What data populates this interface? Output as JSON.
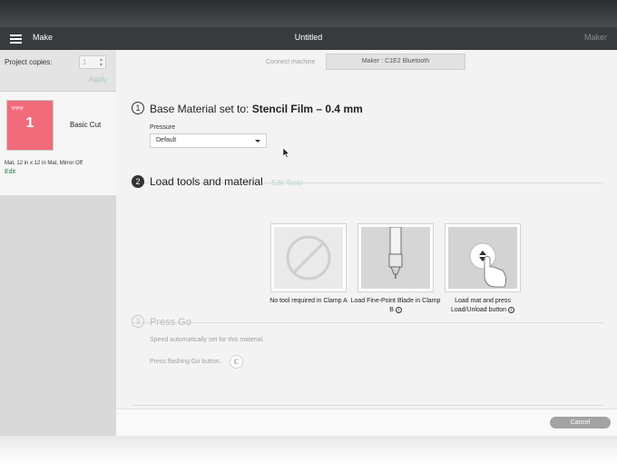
{
  "window": {
    "menu_label": "Make",
    "title": "Untitled",
    "right_label": "Maker"
  },
  "sidebar": {
    "copies_label": "Project copies:",
    "copies_value": "1",
    "apply_label": "Apply",
    "mat": {
      "number": "1",
      "name": "Basic Cut",
      "info": "Mat, 12 in x 12 in Mat, Mirror Off",
      "edit_label": "Edit"
    }
  },
  "connect": {
    "label": "Connect machine",
    "machine_button": "Maker : C1E2 Bluetooth"
  },
  "step1": {
    "number": "1",
    "prefix": "Base Material set to:",
    "material": "Stencil Film – 0.4 mm",
    "pressure_label": "Pressure",
    "pressure_value": "Default"
  },
  "step2": {
    "number": "2",
    "title": "Load tools and material",
    "edit_tools": "Edit Tools",
    "tiles": [
      {
        "caption": "No tool required in Clamp A"
      },
      {
        "caption": "Load Fine-Point Blade in Clamp B"
      },
      {
        "caption": "Load mat and press Load/Unload button"
      }
    ]
  },
  "step3": {
    "number": "3",
    "title": "Press Go",
    "speed_note": "Speed automatically set for this material.",
    "press_note": "Press flashing Go button."
  },
  "footer": {
    "cancel_label": "Cancel"
  },
  "colors": {
    "accent_green": "#1f7a4d",
    "mat_pink": "#f26b7a",
    "titlebar": "#383b3e"
  }
}
